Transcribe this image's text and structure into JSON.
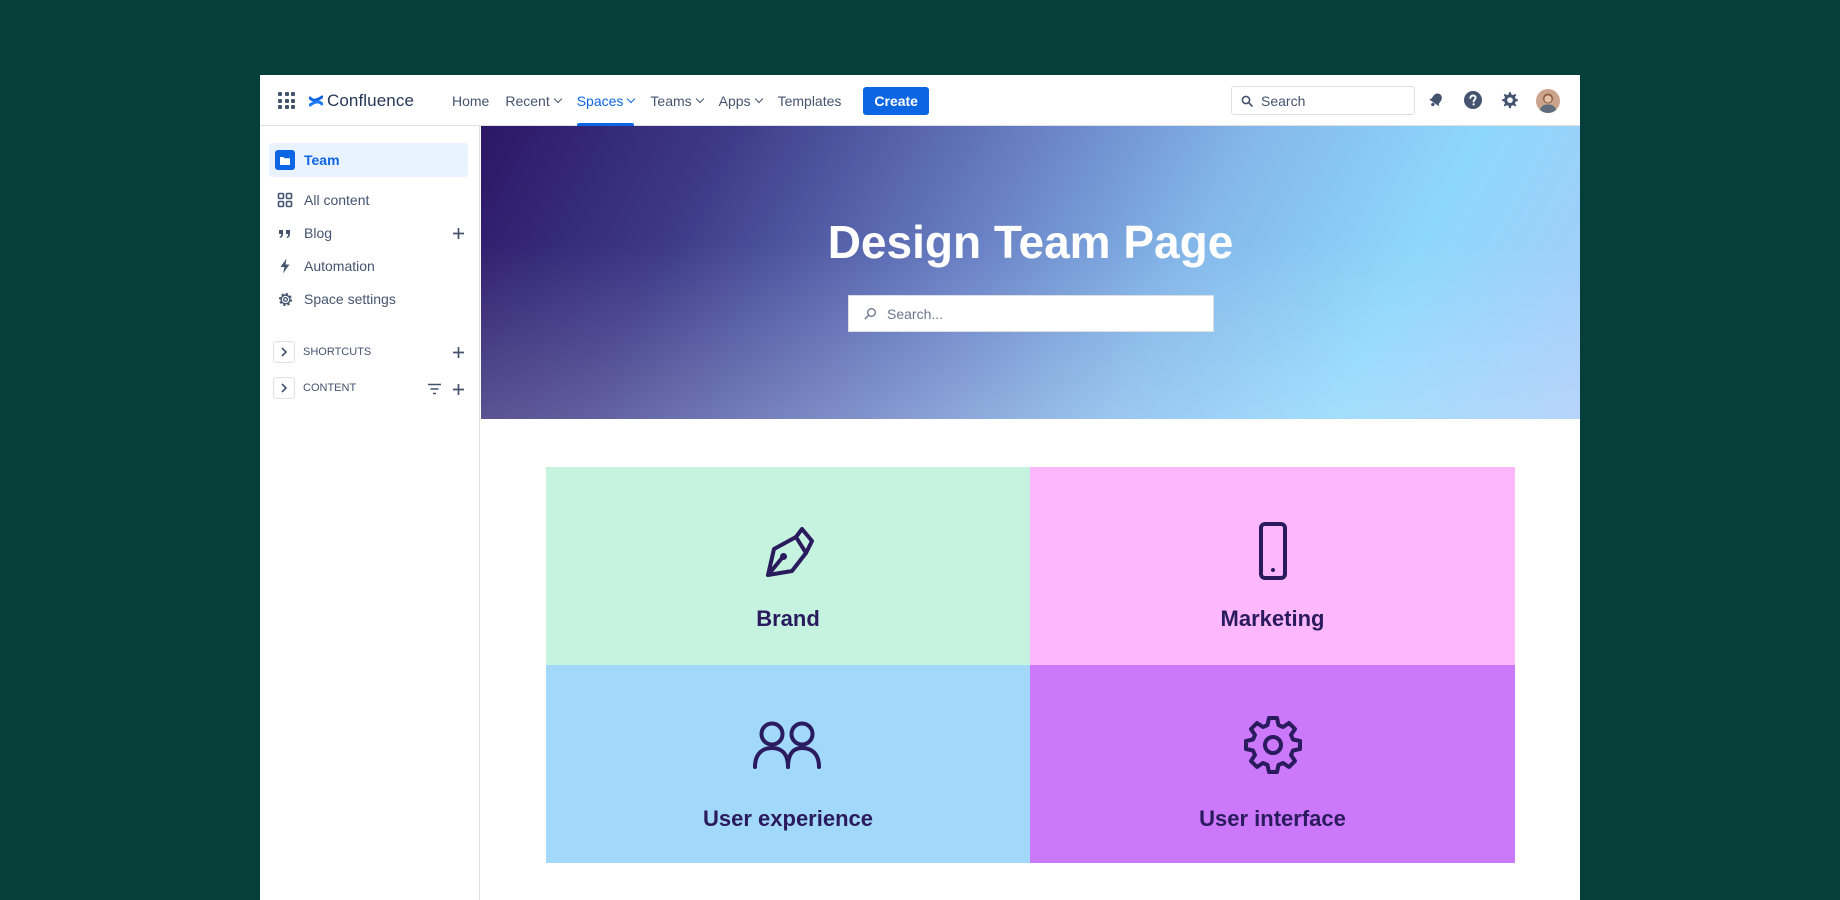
{
  "colors": {
    "background": "#063f3a",
    "accent": "#0c66e4",
    "tile_brand": "#c6f3df",
    "tile_marketing": "#fdb8fd",
    "tile_user_experience": "#a2d8fa",
    "tile_user_interface": "#cb78fa",
    "tile_text": "#2a1a5e"
  },
  "topnav": {
    "app_name": "Confluence",
    "items": [
      {
        "label": "Home",
        "icon": null
      },
      {
        "label": "Recent",
        "icon": "chevron-down-icon"
      },
      {
        "label": "Spaces",
        "icon": "chevron-down-icon",
        "active": true
      },
      {
        "label": "Teams",
        "icon": "chevron-down-icon"
      },
      {
        "label": "Apps",
        "icon": "chevron-down-icon"
      },
      {
        "label": "Templates",
        "icon": null
      }
    ],
    "create_label": "Create",
    "search_placeholder": "Search",
    "icons": [
      "notification-bell-icon",
      "help-icon",
      "settings-gear-icon",
      "user-avatar"
    ]
  },
  "sidebar": {
    "space_name": "Team",
    "items": [
      {
        "label": "All content",
        "icon": "grid-icon"
      },
      {
        "label": "Blog",
        "icon": "quote-icon"
      },
      {
        "label": "Automation",
        "icon": "lightning-icon"
      },
      {
        "label": "Space settings",
        "icon": "gear-icon"
      }
    ],
    "sections": [
      {
        "label": "SHORTCUTS"
      },
      {
        "label": "CONTENT"
      }
    ]
  },
  "hero": {
    "title": "Design Team Page",
    "search_placeholder": "Search..."
  },
  "tiles": [
    {
      "label": "Brand",
      "icon": "pen-nib-icon"
    },
    {
      "label": "Marketing",
      "icon": "mobile-phone-icon"
    },
    {
      "label": "User experience",
      "icon": "users-icon"
    },
    {
      "label": "User interface",
      "icon": "gear-icon"
    }
  ]
}
